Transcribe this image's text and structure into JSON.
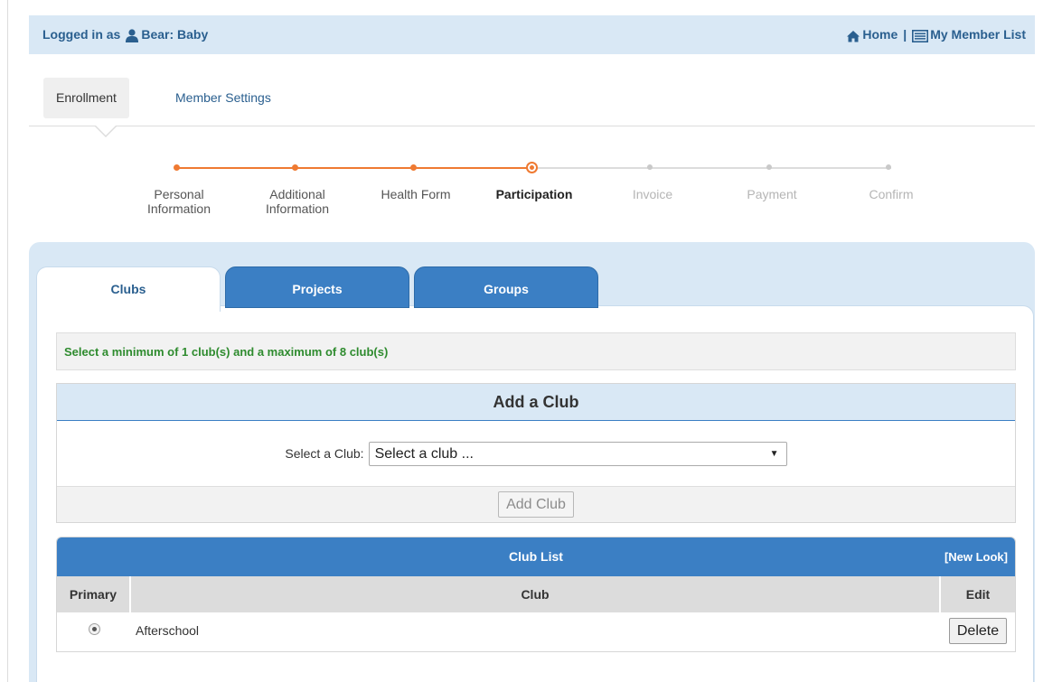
{
  "header": {
    "logged_prefix": "Logged in as",
    "user_name": "Bear: Baby",
    "home_label": "Home",
    "separator": "|",
    "member_list_label": "My Member List"
  },
  "nav": {
    "tabs": [
      {
        "label": "Enrollment",
        "active": true
      },
      {
        "label": "Member Settings",
        "active": false
      }
    ]
  },
  "stepper": {
    "steps": [
      {
        "line1": "Personal",
        "line2": "Information",
        "state": "done"
      },
      {
        "line1": "Additional",
        "line2": "Information",
        "state": "done"
      },
      {
        "line1": "Health Form",
        "line2": "",
        "state": "done"
      },
      {
        "line1": "Participation",
        "line2": "",
        "state": "current"
      },
      {
        "line1": "Invoice",
        "line2": "",
        "state": "todo"
      },
      {
        "line1": "Payment",
        "line2": "",
        "state": "todo"
      },
      {
        "line1": "Confirm",
        "line2": "",
        "state": "todo"
      }
    ],
    "colors": {
      "done": "#ef7a32",
      "todo": "#c9c9c9"
    }
  },
  "tabs": [
    {
      "label": "Clubs",
      "active": true
    },
    {
      "label": "Projects",
      "active": false
    },
    {
      "label": "Groups",
      "active": false
    }
  ],
  "notice": "Select a minimum of 1 club(s) and a maximum of 8 club(s)",
  "add_club": {
    "title": "Add a Club",
    "select_label": "Select a Club:",
    "select_value": "Select a club ...",
    "button_label": "Add Club"
  },
  "club_list": {
    "title": "Club List",
    "new_look": "[New Look]",
    "columns": {
      "primary": "Primary",
      "club": "Club",
      "edit": "Edit"
    },
    "rows": [
      {
        "club": "Afterschool",
        "primary": true,
        "action": "Delete"
      }
    ]
  },
  "colors": {
    "accent": "#3b7fc4",
    "header_bg": "#d9e8f5",
    "notice_text": "#2e8b2e",
    "progress": "#ef7a32"
  }
}
